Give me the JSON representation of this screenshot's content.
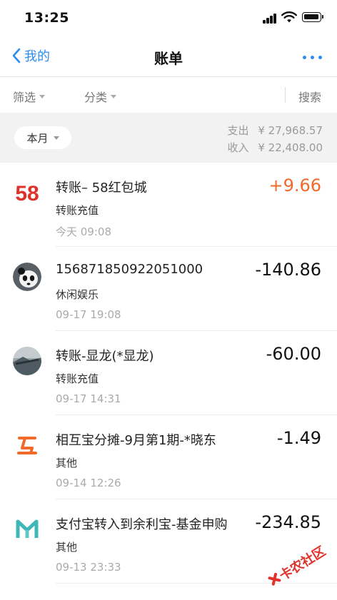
{
  "status_bar": {
    "time": "13:25"
  },
  "nav": {
    "back_label": "我的",
    "title": "账单"
  },
  "filters": {
    "filter_label": "筛选",
    "category_label": "分类",
    "search_label": "搜索"
  },
  "summary": {
    "month_label": "本月",
    "expense_label": "支出",
    "expense_value": "¥ 27,968.57",
    "income_label": "收入",
    "income_value": "¥ 22,408.00"
  },
  "transactions": [
    {
      "icon": "58-logo-icon",
      "title": "转账– 58红包城",
      "category": "转账充值",
      "time": "今天 09:08",
      "amount": "+9.66",
      "color": "#f06a2a"
    },
    {
      "icon": "panda-avatar-icon",
      "title": "156871850922051000",
      "category": "休闲娱乐",
      "time": "09-17  19:08",
      "amount": "-140.86"
    },
    {
      "icon": "landscape-avatar-icon",
      "title": "转账-显龙(*显龙)",
      "category": "转账充值",
      "time": "09-17  14:31",
      "amount": "-60.00"
    },
    {
      "icon": "huhubao-logo-icon",
      "title": "相互宝分摊-9月第1期-*晓东",
      "category": "其他",
      "time": "09-14  12:26",
      "amount": "-1.49"
    },
    {
      "icon": "yulibao-logo-icon",
      "title": "支付宝转入到余利宝-基金申购",
      "category": "其他",
      "time": "09-13  23:33",
      "amount": "-234.85"
    }
  ],
  "watermark": {
    "text": "卡农社区"
  },
  "colors": {
    "accent": "#2d8cf0",
    "positive": "#f06a2a",
    "summary_bg": "#f2f2f2"
  }
}
